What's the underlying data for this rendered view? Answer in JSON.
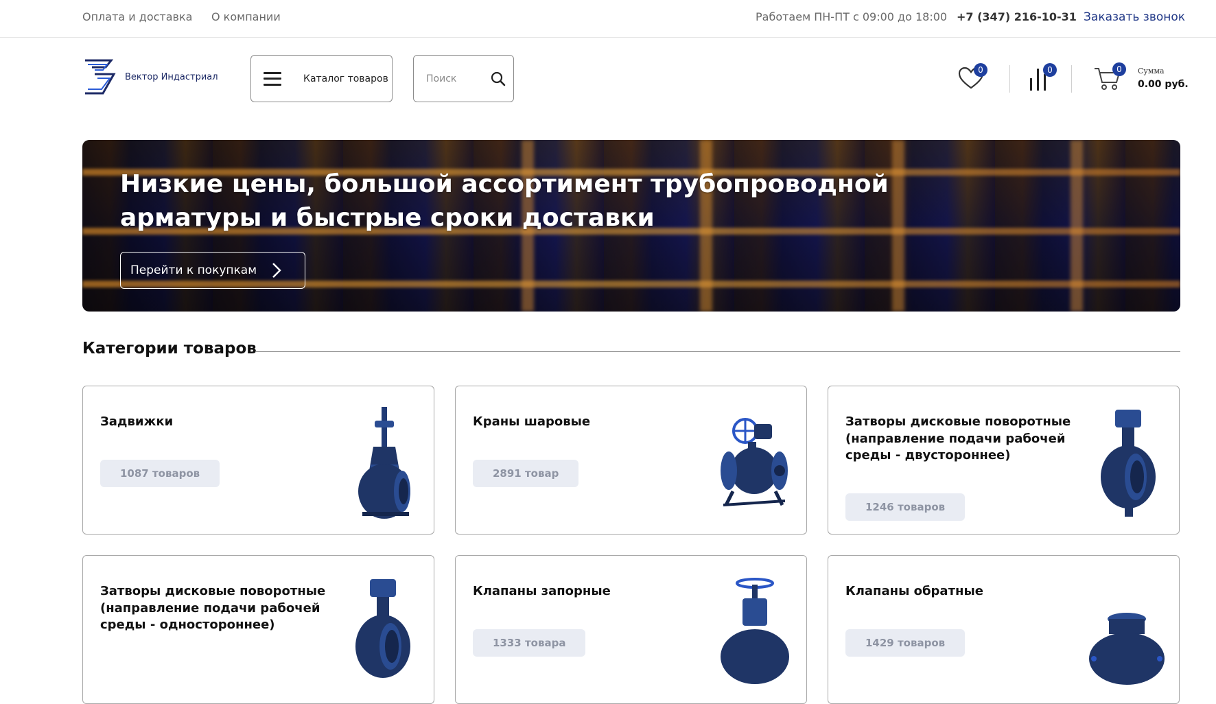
{
  "topbar": {
    "links": [
      "Оплата и доставка",
      "О компании"
    ],
    "hours": "Работаем ПН-ПТ с 09:00 до 18:00",
    "phone": "+7 (347) 216-10-31",
    "callback": "Заказать звонок"
  },
  "header": {
    "logo_text": "Вектор Индастриал",
    "catalog_label": "Каталог товаров",
    "search_placeholder": "Поиск",
    "favorites_count": "0",
    "compare_count": "0",
    "cart_count": "0",
    "cart_sum_label": "Сумма",
    "cart_sum_value": "0.00 руб."
  },
  "banner": {
    "title": "Низкие цены, большой ассортимент трубопроводной арматуры и быстрые сроки доставки",
    "button_label": "Перейти к покупкам"
  },
  "categories": {
    "heading": "Категории товаров",
    "items": [
      {
        "title": "Задвижки",
        "count": "1087 товаров",
        "icon": "gate-valve-icon"
      },
      {
        "title": "Краны шаровые",
        "count": "2891 товар",
        "icon": "ball-valve-icon"
      },
      {
        "title": "Затворы дисковые поворотные (направление подачи рабочей среды - двустороннее)",
        "count": "1246 товаров",
        "icon": "butterfly-valve-icon"
      },
      {
        "title": "Затворы дисковые поворотные (направление подачи рабочей среды - одностороннее)",
        "count": "",
        "icon": "butterfly-valve-icon"
      },
      {
        "title": "Клапаны запорные",
        "count": "1333 товара",
        "icon": "globe-valve-icon"
      },
      {
        "title": "Клапаны обратные",
        "count": "1429 товаров",
        "icon": "check-valve-icon"
      }
    ]
  },
  "colors": {
    "accent": "#1e3f9e",
    "valve": "#1f3566",
    "link": "#233a88"
  }
}
